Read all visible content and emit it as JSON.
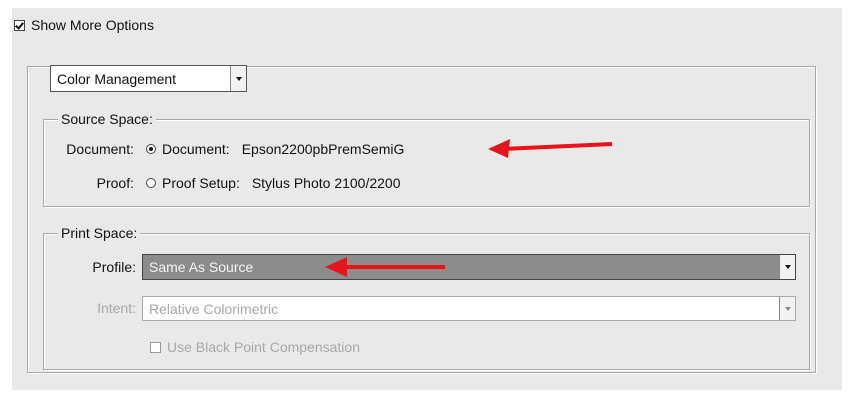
{
  "show_more_options": {
    "label": "Show More Options",
    "checked": true
  },
  "mode_select": {
    "value": "Color Management"
  },
  "source_space": {
    "title": "Source Space:",
    "document_row_label": "Document:",
    "document_option_label": "Document:",
    "document_profile": "Epson2200pbPremSemiG",
    "proof_row_label": "Proof:",
    "proof_option_label": "Proof Setup:",
    "proof_profile": "Stylus Photo 2100/2200",
    "selected": "document"
  },
  "print_space": {
    "title": "Print Space:",
    "profile_label": "Profile:",
    "profile_value": "Same As Source",
    "intent_label": "Intent:",
    "intent_value": "Relative Colorimetric",
    "bpc_label": "Use Black Point Compensation",
    "bpc_checked": false
  },
  "annotation_color": "#e8141b",
  "icons": [
    "checkbox-icon",
    "radio-icon",
    "dropdown-arrow-icon",
    "red-arrow-icon"
  ]
}
